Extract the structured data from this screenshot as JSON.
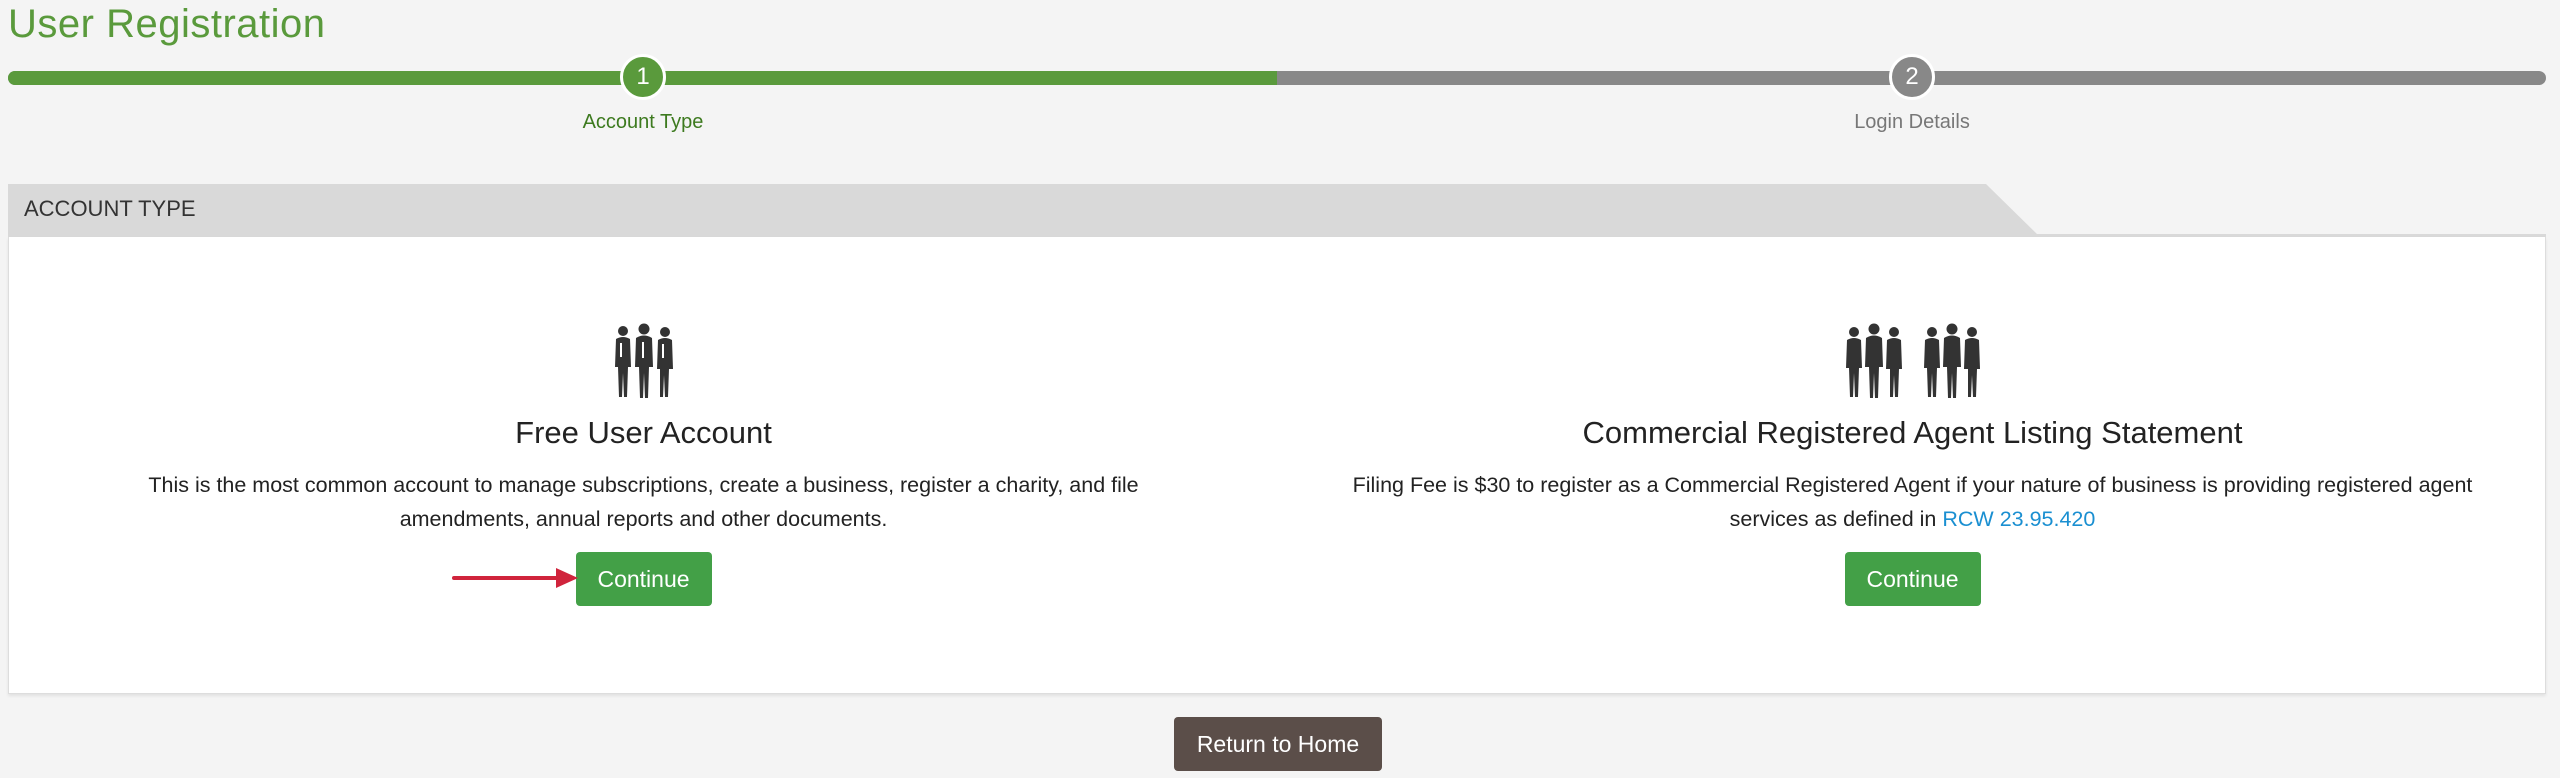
{
  "page": {
    "title": "User Registration"
  },
  "progress": {
    "percent_complete": 50,
    "steps": [
      {
        "number": "1",
        "label": "Account Type",
        "status": "active"
      },
      {
        "number": "2",
        "label": "Login Details",
        "status": "pending"
      }
    ]
  },
  "panel": {
    "tab_label": "ACCOUNT TYPE"
  },
  "options": [
    {
      "icon": "people-group-icon",
      "title": "Free User Account",
      "description": "This is the most common account to manage subscriptions, create a business, register a charity, and file amendments, annual reports and other documents.",
      "button_label": "Continue"
    },
    {
      "icon": "people-group-large-icon",
      "title": "Commercial Registered Agent Listing Statement",
      "description_prefix": "Filing Fee is $30 to register as a Commercial Registered Agent if your nature of business is providing registered agent services as defined in ",
      "description_link": "RCW 23.95.420",
      "button_label": "Continue"
    }
  ],
  "footer": {
    "return_label": "Return to Home"
  },
  "colors": {
    "brand_green": "#5a9a3c",
    "button_green": "#43a047",
    "pending_gray": "#888888",
    "link_blue": "#1a8fd1",
    "annotation_arrow": "#d0243c"
  }
}
